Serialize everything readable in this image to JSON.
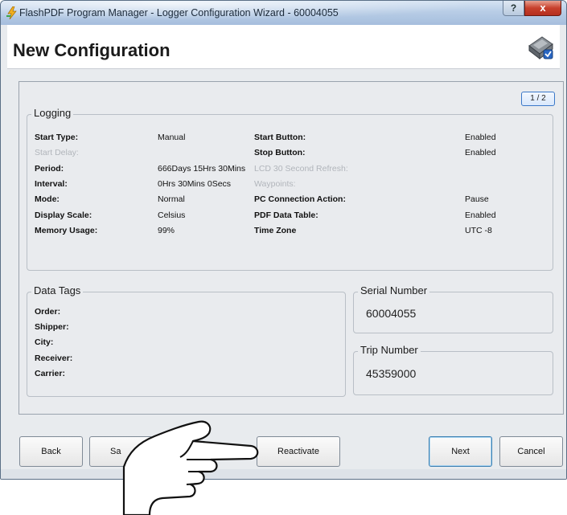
{
  "window": {
    "title": "FlashPDF Program Manager - Logger Configuration Wizard - 60004055",
    "help_label": "?",
    "close_label": "x"
  },
  "header": {
    "title": "New Configuration",
    "icon": "logger-device-icon"
  },
  "page_indicator": "1 / 2",
  "logging": {
    "legend": "Logging",
    "left": [
      {
        "label": "Start Type:",
        "value": "Manual"
      },
      {
        "label": "Start Delay:",
        "value": ""
      },
      {
        "label": "Period:",
        "value": "666Days 15Hrs 30Mins"
      },
      {
        "label": "Interval:",
        "value": "0Hrs 30Mins 0Secs"
      },
      {
        "label": "Mode:",
        "value": "Normal"
      },
      {
        "label": "Display Scale:",
        "value": "Celsius"
      },
      {
        "label": "Memory Usage:",
        "value": "99%"
      }
    ],
    "right": [
      {
        "label": "Start Button:",
        "value": "Enabled"
      },
      {
        "label": "Stop Button:",
        "value": "Enabled"
      },
      {
        "label": "LCD 30 Second Refresh:",
        "value": ""
      },
      {
        "label": "Waypoints:",
        "value": ""
      },
      {
        "label": "PC Connection Action:",
        "value": "Pause"
      },
      {
        "label": "PDF Data Table:",
        "value": "Enabled"
      },
      {
        "label": "Time Zone",
        "value": "UTC -8"
      }
    ]
  },
  "data_tags": {
    "legend": "Data Tags",
    "items": [
      "Order:",
      "Shipper:",
      "City:",
      "Receiver:",
      "Carrier:"
    ]
  },
  "serial_number": {
    "legend": "Serial Number",
    "value": "60004055"
  },
  "trip_number": {
    "legend": "Trip Number",
    "value": "45359000"
  },
  "buttons": {
    "back": "Back",
    "save": "Sa",
    "reactivate": "Reactivate",
    "next": "Next",
    "cancel": "Cancel"
  },
  "colors": {
    "titlebar": "#b8cde6",
    "panel": "#e9ebee",
    "accent": "#3b78c8",
    "close": "#c7402c"
  }
}
